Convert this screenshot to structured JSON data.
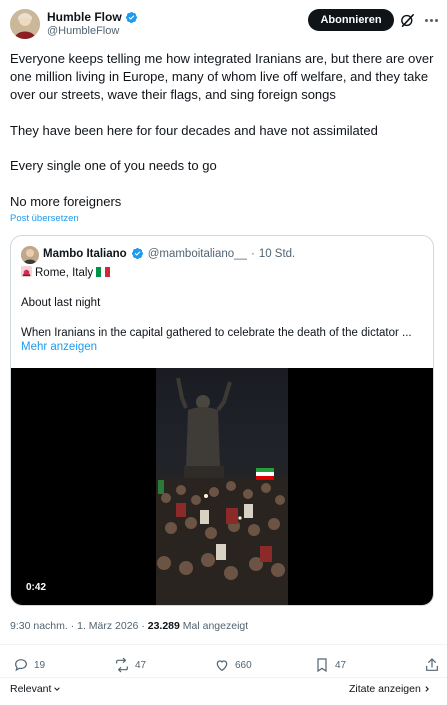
{
  "author": {
    "name": "Humble Flow",
    "handle": "@HumbleFlow"
  },
  "header": {
    "follow_label": "Abonnieren"
  },
  "tweet": {
    "paragraphs": [
      "Everyone keeps telling me how integrated Iranians are, but there are over one million living in Europe, many of whom live off welfare, and they take over our streets, wave their flags, and sing foreign songs",
      "They have been here for four decades and have not assimilated",
      "Every single one of you needs to go",
      "No more foreigners"
    ],
    "translate_label": "Post übersetzen"
  },
  "quote": {
    "name": "Mambo Italiano",
    "handle": "@mamboitaliano__",
    "separator": "·",
    "time": "10 Std.",
    "location": "Rome, Italy",
    "line1": "About last night",
    "line2": "When Iranians in the capital gathered to celebrate the death of the dictator ...",
    "more_label": "Mehr anzeigen",
    "video_timestamp": "0:42"
  },
  "meta": {
    "time_date": "9:30 nachm. · 1. März 2026 ·",
    "views_count": "23.289",
    "views_label": "Mal angezeigt"
  },
  "actions": {
    "replies": "19",
    "reposts": "47",
    "likes": "660",
    "bookmarks": "47"
  },
  "footer": {
    "sort_label": "Relevant",
    "quotes_label": "Zitate anzeigen"
  },
  "colors": {
    "accent": "#1d9bf0",
    "text": "#0f1419",
    "muted": "#536471",
    "border": "#cfd9de"
  },
  "icons": [
    "verified-badge-icon",
    "grok-icon",
    "more-icon",
    "siren-icon",
    "italy-flag-icon",
    "reply-icon",
    "repost-icon",
    "like-icon",
    "bookmark-icon",
    "share-icon",
    "chevron-down-icon",
    "chevron-right-icon"
  ]
}
